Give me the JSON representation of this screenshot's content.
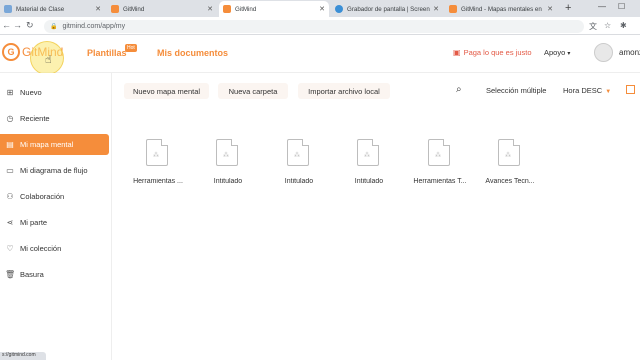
{
  "browser": {
    "tabs": [
      {
        "title": "Material de Clase",
        "color": "#7aa7d8"
      },
      {
        "title": "GitMind",
        "color": "#f58d3b"
      },
      {
        "title": "GitMind",
        "color": "#f58d3b"
      },
      {
        "title": "Grabador de pantalla | Screen",
        "color": "#3b8fd6"
      },
      {
        "title": "GitMind - Mapas mentales en",
        "color": "#f58d3b"
      }
    ],
    "new_tab": "+",
    "url": "gitmind.com/app/my",
    "status_url": "s://gitmind.com"
  },
  "header": {
    "logo_text": "GitMind",
    "nav": [
      {
        "label": "Plantillas"
      },
      {
        "label": "Mis documentos"
      }
    ],
    "hot_badge": "Hot",
    "pay_label": "Paga lo que es justo",
    "support_label": "Apoyo",
    "user_name": "amonz"
  },
  "sidebar": {
    "items": [
      {
        "label": "Nuevo",
        "icon": "plus-square-icon"
      },
      {
        "label": "Reciente",
        "icon": "clock-icon"
      },
      {
        "label": "Mi mapa mental",
        "icon": "document-icon",
        "active": true
      },
      {
        "label": "Mi diagrama de flujo",
        "icon": "flowchart-icon"
      },
      {
        "label": "Colaboración",
        "icon": "people-icon"
      },
      {
        "label": "Mi parte",
        "icon": "share-icon"
      },
      {
        "label": "Mi colección",
        "icon": "heart-icon"
      },
      {
        "label": "Basura",
        "icon": "trash-icon"
      }
    ]
  },
  "toolbar": {
    "new_map": "Nuevo mapa mental",
    "new_folder": "Nueva carpeta",
    "import": "Importar archivo local",
    "multi_select": "Selección múltiple",
    "sort": "Hora DESC"
  },
  "files": [
    {
      "name": "Herramientas ..."
    },
    {
      "name": "Intitulado"
    },
    {
      "name": "Intitulado"
    },
    {
      "name": "Intitulado"
    },
    {
      "name": "Herramientas T..."
    },
    {
      "name": "Avances Tecn..."
    }
  ],
  "colors": {
    "accent": "#f58d3b",
    "pay": "#e35a46"
  }
}
